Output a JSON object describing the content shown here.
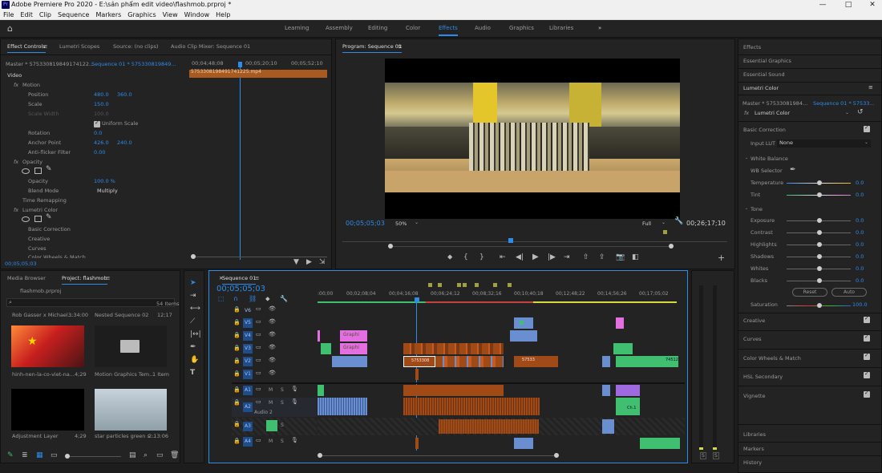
{
  "window": {
    "title": "Adobe Premiere Pro 2020 - E:\\sản phẩm edit video\\flashmob.prproj *",
    "icon_label": "Pr"
  },
  "menu": [
    "File",
    "Edit",
    "Clip",
    "Sequence",
    "Markers",
    "Graphics",
    "View",
    "Window",
    "Help"
  ],
  "workspaces": [
    "Learning",
    "Assembly",
    "Editing",
    "Color",
    "Effects",
    "Audio",
    "Graphics",
    "Libraries"
  ],
  "active_workspace": "Effects",
  "effect_controls": {
    "tabs": [
      "Effect Controls",
      "Lumetri Scopes",
      "Source: (no clips)",
      "Audio Clip Mixer: Sequence 01"
    ],
    "master": "Master * 575330819849174122...",
    "sequence": "Sequence 01 * 575330819849...",
    "ruler": [
      "00;04;48;08",
      "00;05;20;10",
      "00;05;52;10"
    ],
    "clip_name": "575330819849174122​5.mp4",
    "video_label": "Video",
    "motion": "Motion",
    "position_label": "Position",
    "position_x": "480.0",
    "position_y": "360.0",
    "scale_label": "Scale",
    "scale_val": "150.0",
    "scale_width_label": "Scale Width",
    "scale_width_val": "100.0",
    "uniform_scale": "Uniform Scale",
    "rotation_label": "Rotation",
    "rotation_val": "0.0",
    "anchor_label": "Anchor Point",
    "anchor_x": "426.0",
    "anchor_y": "240.0",
    "antiflicker_label": "Anti-flicker Filter",
    "antiflicker_val": "0.00",
    "opacity": "Opacity",
    "opacity_label": "Opacity",
    "opacity_val": "100.0 %",
    "blend_label": "Blend Mode",
    "blend_val": "Multiply",
    "time_remap": "Time Remapping",
    "lumetri": "Lumetri Color",
    "basic": "Basic Correction",
    "creative": "Creative",
    "curves": "Curves",
    "wheels": "Color Wheels & Match",
    "timecode": "00;05;05;03"
  },
  "program": {
    "title": "Program: Sequence 01",
    "timecode": "00;05;05;03",
    "zoom": "50%",
    "quality": "Full",
    "duration": "00;26;17;10"
  },
  "project": {
    "tabs": [
      "Media Browser",
      "Project: flashmob"
    ],
    "file": "flashmob.prproj",
    "items_count": "54 Items",
    "list_top": [
      {
        "name": "Rob Gasser x Michael...",
        "dur": "3:34:00"
      },
      {
        "name": "Nested Sequence 02",
        "dur": "12;17"
      }
    ],
    "thumbs": [
      {
        "name": "hinh-nen-la-co-viet-na...",
        "dur": "4;29"
      },
      {
        "name": "Motion Graphics Tem...",
        "dur": "1 Item"
      },
      {
        "name": "Adjustment Layer",
        "dur": "4;29"
      },
      {
        "name": "star particles green s...",
        "dur": "2:13:06"
      }
    ]
  },
  "timeline": {
    "tab": "Sequence 01",
    "timecode": "00;05;05;03",
    "ruler": [
      ":00;00",
      "00;02;08;04",
      "00;04;16;08",
      "00;06;24;12",
      "00;08;32;16",
      "00;10;40;18",
      "00;12;48;22",
      "00;14;56;26",
      "00;17;05;02"
    ],
    "video_tracks": [
      "V6",
      "V5",
      "V4",
      "V3",
      "V2",
      "V1"
    ],
    "audio_tracks": [
      "A1",
      "A2",
      "A3",
      "A4"
    ],
    "audio2_label": "Audio 2",
    "clip_labels": {
      "graphic1": "Graphi",
      "graphic2": "Graphi",
      "v2a": "5753308",
      "v2b": "57533",
      "v2c": "74512",
      "a2": "Ch.1"
    }
  },
  "lumetri_panel": {
    "tabs_top": [
      "Effects",
      "Essential Graphics",
      "Essential Sound",
      "Lumetri Color"
    ],
    "master": "Master * 57533081984...",
    "sequence": "Sequence 01 * 57533...",
    "fx": "Lumetri Color",
    "basic": "Basic Correction",
    "input_lut_label": "Input LUT",
    "input_lut_val": "None",
    "white_balance": "White Balance",
    "wb_selector": "WB Selector",
    "sliders": [
      {
        "label": "Temperature",
        "val": "0.0"
      },
      {
        "label": "Tint",
        "val": "0.0"
      }
    ],
    "tone": "Tone",
    "tone_sliders": [
      {
        "label": "Exposure",
        "val": "0.0"
      },
      {
        "label": "Contrast",
        "val": "0.0"
      },
      {
        "label": "Highlights",
        "val": "0.0"
      },
      {
        "label": "Shadows",
        "val": "0.0"
      },
      {
        "label": "Whites",
        "val": "0.0"
      },
      {
        "label": "Blacks",
        "val": "0.0"
      }
    ],
    "reset": "Reset",
    "auto": "Auto",
    "saturation_label": "Saturation",
    "saturation_val": "100.0",
    "sections": [
      "Creative",
      "Curves",
      "Color Wheels & Match",
      "HSL Secondary",
      "Vignette"
    ],
    "bottom": [
      "Libraries",
      "Markers",
      "History"
    ]
  },
  "colors": {
    "accent": "#2d8ceb",
    "panel": "#232323",
    "clip_orange": "#a04a18",
    "clip_blue": "#6a8fd0",
    "clip_pink": "#e46fe0",
    "clip_green": "#3fbf6f"
  }
}
